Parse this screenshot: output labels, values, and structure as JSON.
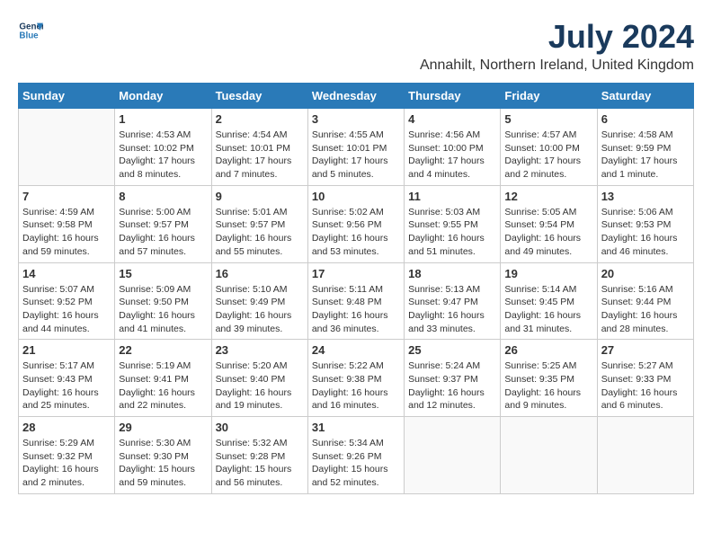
{
  "header": {
    "logo_line1": "General",
    "logo_line2": "Blue",
    "title": "July 2024",
    "subtitle": "Annahilt, Northern Ireland, United Kingdom"
  },
  "days_of_week": [
    "Sunday",
    "Monday",
    "Tuesday",
    "Wednesday",
    "Thursday",
    "Friday",
    "Saturday"
  ],
  "weeks": [
    [
      {
        "day": "",
        "info": ""
      },
      {
        "day": "1",
        "info": "Sunrise: 4:53 AM\nSunset: 10:02 PM\nDaylight: 17 hours\nand 8 minutes."
      },
      {
        "day": "2",
        "info": "Sunrise: 4:54 AM\nSunset: 10:01 PM\nDaylight: 17 hours\nand 7 minutes."
      },
      {
        "day": "3",
        "info": "Sunrise: 4:55 AM\nSunset: 10:01 PM\nDaylight: 17 hours\nand 5 minutes."
      },
      {
        "day": "4",
        "info": "Sunrise: 4:56 AM\nSunset: 10:00 PM\nDaylight: 17 hours\nand 4 minutes."
      },
      {
        "day": "5",
        "info": "Sunrise: 4:57 AM\nSunset: 10:00 PM\nDaylight: 17 hours\nand 2 minutes."
      },
      {
        "day": "6",
        "info": "Sunrise: 4:58 AM\nSunset: 9:59 PM\nDaylight: 17 hours\nand 1 minute."
      }
    ],
    [
      {
        "day": "7",
        "info": "Sunrise: 4:59 AM\nSunset: 9:58 PM\nDaylight: 16 hours\nand 59 minutes."
      },
      {
        "day": "8",
        "info": "Sunrise: 5:00 AM\nSunset: 9:57 PM\nDaylight: 16 hours\nand 57 minutes."
      },
      {
        "day": "9",
        "info": "Sunrise: 5:01 AM\nSunset: 9:57 PM\nDaylight: 16 hours\nand 55 minutes."
      },
      {
        "day": "10",
        "info": "Sunrise: 5:02 AM\nSunset: 9:56 PM\nDaylight: 16 hours\nand 53 minutes."
      },
      {
        "day": "11",
        "info": "Sunrise: 5:03 AM\nSunset: 9:55 PM\nDaylight: 16 hours\nand 51 minutes."
      },
      {
        "day": "12",
        "info": "Sunrise: 5:05 AM\nSunset: 9:54 PM\nDaylight: 16 hours\nand 49 minutes."
      },
      {
        "day": "13",
        "info": "Sunrise: 5:06 AM\nSunset: 9:53 PM\nDaylight: 16 hours\nand 46 minutes."
      }
    ],
    [
      {
        "day": "14",
        "info": "Sunrise: 5:07 AM\nSunset: 9:52 PM\nDaylight: 16 hours\nand 44 minutes."
      },
      {
        "day": "15",
        "info": "Sunrise: 5:09 AM\nSunset: 9:50 PM\nDaylight: 16 hours\nand 41 minutes."
      },
      {
        "day": "16",
        "info": "Sunrise: 5:10 AM\nSunset: 9:49 PM\nDaylight: 16 hours\nand 39 minutes."
      },
      {
        "day": "17",
        "info": "Sunrise: 5:11 AM\nSunset: 9:48 PM\nDaylight: 16 hours\nand 36 minutes."
      },
      {
        "day": "18",
        "info": "Sunrise: 5:13 AM\nSunset: 9:47 PM\nDaylight: 16 hours\nand 33 minutes."
      },
      {
        "day": "19",
        "info": "Sunrise: 5:14 AM\nSunset: 9:45 PM\nDaylight: 16 hours\nand 31 minutes."
      },
      {
        "day": "20",
        "info": "Sunrise: 5:16 AM\nSunset: 9:44 PM\nDaylight: 16 hours\nand 28 minutes."
      }
    ],
    [
      {
        "day": "21",
        "info": "Sunrise: 5:17 AM\nSunset: 9:43 PM\nDaylight: 16 hours\nand 25 minutes."
      },
      {
        "day": "22",
        "info": "Sunrise: 5:19 AM\nSunset: 9:41 PM\nDaylight: 16 hours\nand 22 minutes."
      },
      {
        "day": "23",
        "info": "Sunrise: 5:20 AM\nSunset: 9:40 PM\nDaylight: 16 hours\nand 19 minutes."
      },
      {
        "day": "24",
        "info": "Sunrise: 5:22 AM\nSunset: 9:38 PM\nDaylight: 16 hours\nand 16 minutes."
      },
      {
        "day": "25",
        "info": "Sunrise: 5:24 AM\nSunset: 9:37 PM\nDaylight: 16 hours\nand 12 minutes."
      },
      {
        "day": "26",
        "info": "Sunrise: 5:25 AM\nSunset: 9:35 PM\nDaylight: 16 hours\nand 9 minutes."
      },
      {
        "day": "27",
        "info": "Sunrise: 5:27 AM\nSunset: 9:33 PM\nDaylight: 16 hours\nand 6 minutes."
      }
    ],
    [
      {
        "day": "28",
        "info": "Sunrise: 5:29 AM\nSunset: 9:32 PM\nDaylight: 16 hours\nand 2 minutes."
      },
      {
        "day": "29",
        "info": "Sunrise: 5:30 AM\nSunset: 9:30 PM\nDaylight: 15 hours\nand 59 minutes."
      },
      {
        "day": "30",
        "info": "Sunrise: 5:32 AM\nSunset: 9:28 PM\nDaylight: 15 hours\nand 56 minutes."
      },
      {
        "day": "31",
        "info": "Sunrise: 5:34 AM\nSunset: 9:26 PM\nDaylight: 15 hours\nand 52 minutes."
      },
      {
        "day": "",
        "info": ""
      },
      {
        "day": "",
        "info": ""
      },
      {
        "day": "",
        "info": ""
      }
    ]
  ]
}
